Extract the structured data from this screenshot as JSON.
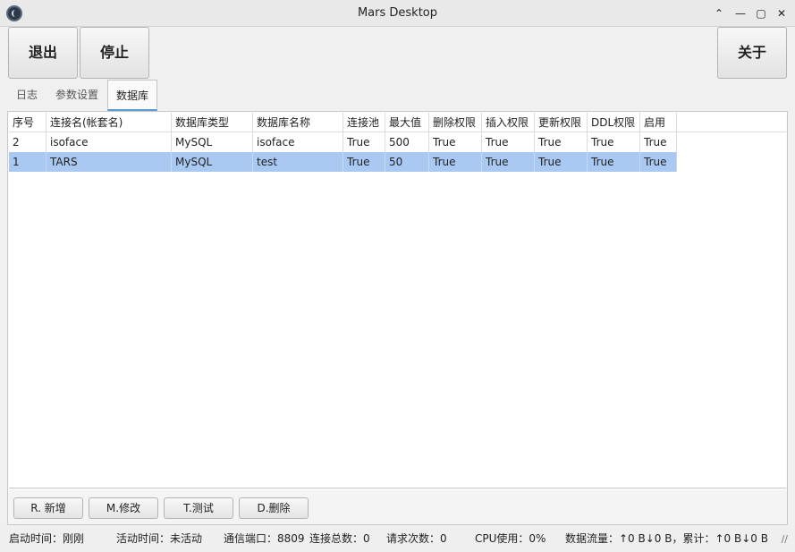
{
  "window": {
    "title": "Mars Desktop"
  },
  "toolbar": {
    "exit_label": "退出",
    "stop_label": "停止",
    "about_label": "关于"
  },
  "tabs": [
    {
      "label": "日志"
    },
    {
      "label": "参数设置"
    },
    {
      "label": "数据库",
      "active": true
    }
  ],
  "table": {
    "columns": [
      "序号",
      "连接名(帐套名)",
      "数据库类型",
      "数据库名称",
      "连接池",
      "最大值",
      "删除权限",
      "插入权限",
      "更新权限",
      "DDL权限",
      "启用"
    ],
    "rows": [
      [
        "2",
        "isoface",
        "MySQL",
        "isoface",
        "True",
        "500",
        "True",
        "True",
        "True",
        "True",
        "True"
      ],
      [
        "1",
        "TARS",
        "MySQL",
        "test",
        "True",
        "50",
        "True",
        "True",
        "True",
        "True",
        "True"
      ]
    ],
    "selected_row": 1
  },
  "actions": {
    "add_label": "R. 新增",
    "edit_label": "M.修改",
    "test_label": "T.测试",
    "delete_label": "D.删除"
  },
  "status": {
    "start_time": "启动时间：刚刚",
    "active_time": "活动时间：未活动",
    "port": "通信端口：8809",
    "connections": "连接总数：0",
    "requests": "请求次数：0",
    "cpu": "CPU使用：0%",
    "traffic": "数据流量：↑0 B↓0 B，累计：↑0 B↓0 B"
  },
  "icons": {
    "app": "app-logo-icon",
    "window_controls": [
      "chevron-up-icon",
      "minimize-icon",
      "maximize-icon",
      "close-icon"
    ],
    "resize": "resize-grip-icon"
  }
}
